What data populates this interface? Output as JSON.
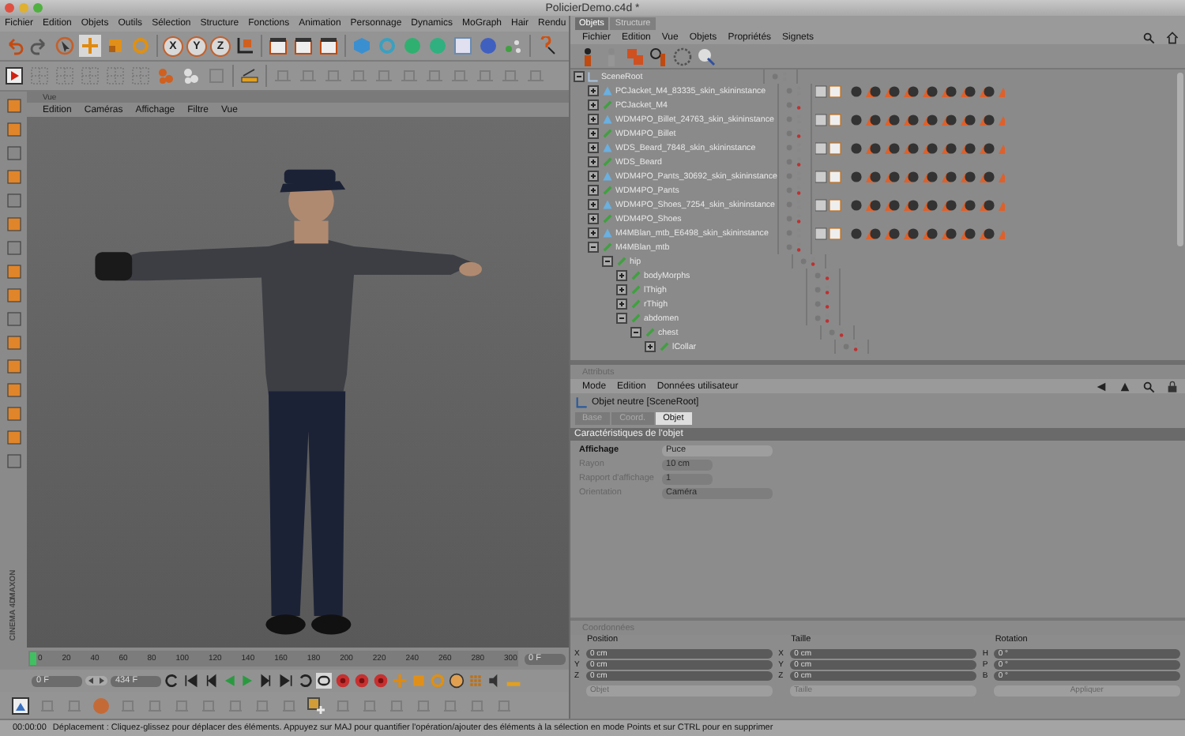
{
  "window": {
    "title": "PolicierDemo.c4d *"
  },
  "menu": [
    "Fichier",
    "Edition",
    "Objets",
    "Outils",
    "Sélection",
    "Structure",
    "Fonctions",
    "Animation",
    "Personnage",
    "Dynamics",
    "MoGraph",
    "Hair",
    "Rendu"
  ],
  "axis_locks": [
    {
      "label": "X",
      "on": true
    },
    {
      "label": "Y",
      "on": true
    },
    {
      "label": "Z",
      "on": true
    }
  ],
  "viewport": {
    "title": "Vue",
    "menu": [
      "Edition",
      "Caméras",
      "Affichage",
      "Filtre",
      "Vue"
    ]
  },
  "logo": {
    "brand": "MAXON",
    "product": "CINEMA 4D"
  },
  "timeline": {
    "ticks": [
      "0",
      "20",
      "40",
      "60",
      "80",
      "100",
      "120",
      "140",
      "160",
      "180",
      "200",
      "220",
      "240",
      "260",
      "280",
      "300"
    ],
    "frame": "0 F"
  },
  "transport": {
    "start": "0 F",
    "end": "434 F"
  },
  "object_manager": {
    "tabs": [
      {
        "label": "Objets",
        "selected": true
      },
      {
        "label": "Structure",
        "selected": false
      }
    ],
    "menu": [
      "Fichier",
      "Edition",
      "Vue",
      "Objets",
      "Propriétés",
      "Signets"
    ],
    "tree": [
      {
        "name": "SceneRoot",
        "kind": "null",
        "expanded": true,
        "children": [
          {
            "name": "PCJacket_M4_83335_skin_skininstance",
            "kind": "skin",
            "expanded": false
          },
          {
            "name": "PCJacket_M4",
            "kind": "bone",
            "expanded": false
          },
          {
            "name": "WDM4PO_Billet_24763_skin_skininstance",
            "kind": "skin",
            "expanded": false
          },
          {
            "name": "WDM4PO_Billet",
            "kind": "bone",
            "expanded": false
          },
          {
            "name": "WDS_Beard_7848_skin_skininstance",
            "kind": "skin",
            "expanded": false
          },
          {
            "name": "WDS_Beard",
            "kind": "bone",
            "expanded": false
          },
          {
            "name": "WDM4PO_Pants_30692_skin_skininstance",
            "kind": "skin",
            "expanded": false
          },
          {
            "name": "WDM4PO_Pants",
            "kind": "bone",
            "expanded": false
          },
          {
            "name": "WDM4PO_Shoes_7254_skin_skininstance",
            "kind": "skin",
            "expanded": false
          },
          {
            "name": "WDM4PO_Shoes",
            "kind": "bone",
            "expanded": false
          },
          {
            "name": "M4MBlan_mtb_E6498_skin_skininstance",
            "kind": "skin",
            "expanded": false
          },
          {
            "name": "M4MBlan_mtb",
            "kind": "bone",
            "expanded": true,
            "children": [
              {
                "name": "hip",
                "kind": "bone",
                "expanded": true,
                "children": [
                  {
                    "name": "bodyMorphs",
                    "kind": "bone",
                    "expanded": false
                  },
                  {
                    "name": "lThigh",
                    "kind": "bone",
                    "expanded": false
                  },
                  {
                    "name": "rThigh",
                    "kind": "bone",
                    "expanded": false
                  },
                  {
                    "name": "abdomen",
                    "kind": "bone",
                    "expanded": true,
                    "children": [
                      {
                        "name": "chest",
                        "kind": "bone",
                        "expanded": true,
                        "children": [
                          {
                            "name": "lCollar",
                            "kind": "bone",
                            "expanded": false
                          }
                        ]
                      }
                    ]
                  }
                ]
              }
            ]
          }
        ]
      }
    ]
  },
  "attributes": {
    "title": "Attributs",
    "menu": [
      "Mode",
      "Edition",
      "Données utilisateur"
    ],
    "object_title": "Objet neutre [SceneRoot]",
    "tabs": [
      {
        "label": "Base",
        "selected": false
      },
      {
        "label": "Coord.",
        "selected": false
      },
      {
        "label": "Objet",
        "selected": true
      }
    ],
    "section": "Caractéristiques de l'objet",
    "fields": [
      {
        "label": "Affichage",
        "value": "Puce",
        "kind": "dropdown",
        "disabled": false
      },
      {
        "label": "Rayon",
        "value": "10 cm",
        "kind": "number",
        "disabled": true
      },
      {
        "label": "Rapport d'affichage",
        "value": "1",
        "kind": "number",
        "disabled": true
      },
      {
        "label": "Orientation",
        "value": "Caméra",
        "kind": "dropdown",
        "disabled": true
      }
    ]
  },
  "coordinates": {
    "title": "Coordonnées",
    "columns": [
      {
        "heading": "Position",
        "rows": [
          {
            "axis": "X",
            "value": "0 cm"
          },
          {
            "axis": "Y",
            "value": "0 cm"
          },
          {
            "axis": "Z",
            "value": "0 cm"
          }
        ],
        "footer": {
          "kind": "dropdown",
          "label": "Objet"
        }
      },
      {
        "heading": "Taille",
        "rows": [
          {
            "axis": "X",
            "value": "0 cm"
          },
          {
            "axis": "Y",
            "value": "0 cm"
          },
          {
            "axis": "Z",
            "value": "0 cm"
          }
        ],
        "footer": {
          "kind": "dropdown",
          "label": "Taille"
        }
      },
      {
        "heading": "Rotation",
        "rows": [
          {
            "axis": "H",
            "value": "0 °"
          },
          {
            "axis": "P",
            "value": "0 °"
          },
          {
            "axis": "B",
            "value": "0 °"
          }
        ],
        "footer": {
          "kind": "button",
          "label": "Appliquer"
        }
      }
    ]
  },
  "status_bar": {
    "time": "00:00:00",
    "message": "Déplacement : Cliquez-glissez pour déplacer des éléments. Appuyez sur MAJ pour quantifier l'opération/ajouter des éléments à la sélection en mode Points et sur CTRL pour en supprimer"
  }
}
